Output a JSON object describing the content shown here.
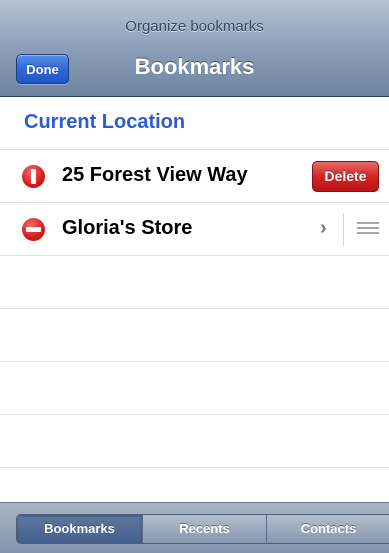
{
  "header": {
    "prompt": "Organize bookmarks",
    "title": "Bookmarks",
    "done_label": "Done"
  },
  "list": {
    "current_location_label": "Current Location",
    "items": [
      {
        "label": "25 Forest View Way",
        "delete_label": "Delete",
        "state": "confirm-delete"
      },
      {
        "label": "Gloria's Store",
        "disclosure": "›",
        "state": "editing"
      }
    ]
  },
  "tabs": [
    {
      "label": "Bookmarks",
      "selected": true
    },
    {
      "label": "Recents",
      "selected": false
    },
    {
      "label": "Contacts",
      "selected": false
    }
  ],
  "colors": {
    "link_blue": "#2a5ed0",
    "delete_red": "#d32525",
    "nav_bar": "#8d9fb7",
    "done_blue": "#2f68d6"
  }
}
